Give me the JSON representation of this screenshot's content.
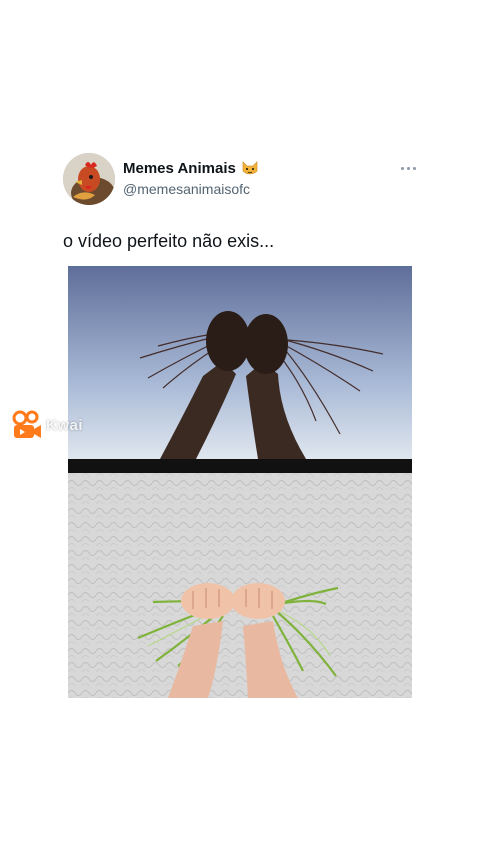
{
  "author": {
    "name": "Memes Animais",
    "emoji": "cat-face-icon",
    "handle": "@memesanimaisofc"
  },
  "tweet": {
    "text": "o vídeo perfeito não exis..."
  },
  "watermark": {
    "brand": "Kwai",
    "icon": "kwai-logo-icon",
    "color": "#ff7a1a"
  },
  "colors": {
    "name": "#0f1419",
    "handle": "#536471",
    "more": "#8b98a5"
  }
}
